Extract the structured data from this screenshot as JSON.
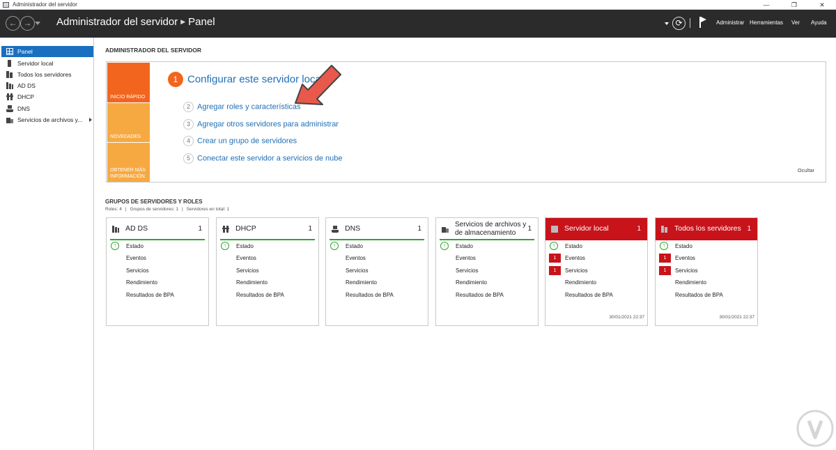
{
  "window": {
    "title": "Administrador del servidor",
    "controls": [
      "—",
      "❐",
      "✕"
    ]
  },
  "header": {
    "breadcrumb_root": "Administrador del servidor",
    "breadcrumb_current": "Panel",
    "menu": {
      "manage": "Administrar",
      "tools": "Herramientas",
      "view": "Ver",
      "help": "Ayuda"
    }
  },
  "sidebar": {
    "items": [
      {
        "label": "Panel"
      },
      {
        "label": "Servidor local"
      },
      {
        "label": "Todos los servidores"
      },
      {
        "label": "AD DS"
      },
      {
        "label": "DHCP"
      },
      {
        "label": "DNS"
      },
      {
        "label": "Servicios de archivos y..."
      }
    ]
  },
  "main": {
    "title": "ADMINISTRADOR DEL SERVIDOR",
    "welcome": {
      "tiles": [
        "INICIO RÁPIDO",
        "NOVEDADES",
        "OBTENER MÁS INFORMACIÓN"
      ],
      "step1": {
        "num": "1",
        "text": "Configurar este servidor local"
      },
      "steps": [
        {
          "num": "2",
          "text": "Agregar roles y características"
        },
        {
          "num": "3",
          "text": "Agregar otros servidores para administrar"
        },
        {
          "num": "4",
          "text": "Crear un grupo de servidores"
        },
        {
          "num": "5",
          "text": "Conectar este servidor a servicios de nube"
        }
      ],
      "hide": "Ocultar"
    },
    "groups": {
      "title": "GRUPOS DE SERVIDORES Y ROLES",
      "roles": "Roles: 4",
      "server_groups": "Grupos de servidores: 1",
      "servers_total": "Servidores en total: 1",
      "separator": "|"
    },
    "cards": [
      {
        "title": "AD DS",
        "count": "1",
        "status": "ok",
        "rows": [
          "Estado",
          "Eventos",
          "Servicios",
          "Rendimiento",
          "Resultados de BPA"
        ],
        "badges": [
          "",
          "",
          "",
          "",
          ""
        ],
        "time": ""
      },
      {
        "title": "DHCP",
        "count": "1",
        "status": "ok",
        "rows": [
          "Estado",
          "Eventos",
          "Servicios",
          "Rendimiento",
          "Resultados de BPA"
        ],
        "badges": [
          "",
          "",
          "",
          "",
          ""
        ],
        "time": ""
      },
      {
        "title": "DNS",
        "count": "1",
        "status": "ok",
        "rows": [
          "Estado",
          "Eventos",
          "Servicios",
          "Rendimiento",
          "Resultados de BPA"
        ],
        "badges": [
          "",
          "",
          "",
          "",
          ""
        ],
        "time": ""
      },
      {
        "title": "Servicios de archivos y de almacenamiento",
        "count": "1",
        "status": "ok",
        "rows": [
          "Estado",
          "Eventos",
          "Servicios",
          "Rendimiento",
          "Resultados de BPA"
        ],
        "badges": [
          "",
          "",
          "",
          "",
          ""
        ],
        "time": ""
      },
      {
        "title": "Servidor local",
        "count": "1",
        "status": "alert",
        "rows": [
          "Estado",
          "Eventos",
          "Servicios",
          "Rendimiento",
          "Resultados de BPA"
        ],
        "badges": [
          "",
          "1",
          "1",
          "",
          ""
        ],
        "time": "30/01/2021 22:37"
      },
      {
        "title": "Todos los servidores",
        "count": "1",
        "status": "alert",
        "rows": [
          "Estado",
          "Eventos",
          "Servicios",
          "Rendimiento",
          "Resultados de BPA"
        ],
        "badges": [
          "",
          "1",
          "1",
          "",
          ""
        ],
        "time": "30/01/2021 22:37"
      }
    ]
  },
  "colors": {
    "header_bg": "#2b2b2b",
    "accent_blue": "#1a6fc0",
    "orange": "#f2651e",
    "light_orange": "#f7a941",
    "alert_red": "#c8131b",
    "ok_green": "#2fa52f",
    "link_blue": "#1f6fb5"
  },
  "icons": {
    "back": "arrow-left-icon",
    "forward": "arrow-right-icon",
    "refresh": "refresh-icon",
    "flag": "flag-icon"
  }
}
